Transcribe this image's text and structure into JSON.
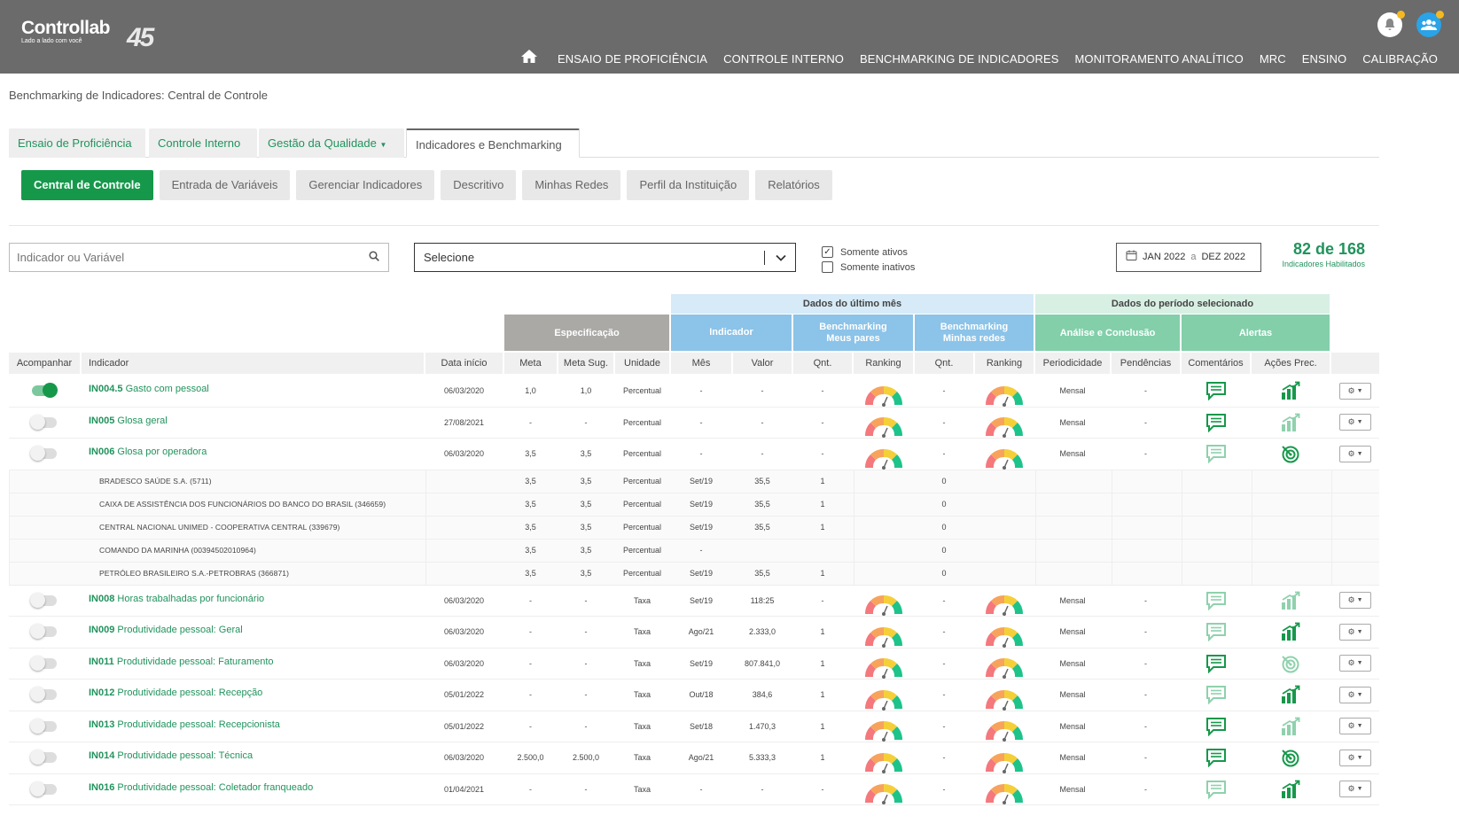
{
  "header": {
    "logo_text": "Controllab",
    "logo_tagline": "Lado a lado com você",
    "logo_anniversary": "45",
    "nav": [
      "ENSAIO DE PROFICIÊNCIA",
      "CONTROLE INTERNO",
      "BENCHMARKING DE INDICADORES",
      "MONITORAMENTO ANALÍTICO",
      "MRC",
      "ENSINO",
      "CALIBRAÇÃO"
    ]
  },
  "breadcrumb": "Benchmarking de Indicadores: Central de Controle",
  "tabs": [
    "Ensaio de Proficiência",
    "Controle Interno",
    "Gestão da Qualidade",
    "Indicadores e Benchmarking"
  ],
  "subtabs": [
    "Central de Controle",
    "Entrada de Variáveis",
    "Gerenciar Indicadores",
    "Descritivo",
    "Minhas Redes",
    "Perfil da Instituição",
    "Relatórios"
  ],
  "filters": {
    "search_placeholder": "Indicador ou Variável",
    "select_value": "Selecione",
    "only_active": "Somente ativos",
    "only_inactive": "Somente inativos",
    "date_from": "JAN 2022",
    "date_sep": "a",
    "date_to": "DEZ 2022",
    "count": "82 de 168",
    "count_label": "Indicadores Habilitados"
  },
  "table": {
    "group_last_month": "Dados do último mês",
    "group_period": "Dados do período selecionado",
    "sub_spec": "Especificação",
    "sub_indicator": "Indicador",
    "sub_bench_peers_1": "Benchmarking",
    "sub_bench_peers_2": "Meus pares",
    "sub_bench_nets_1": "Benchmarking",
    "sub_bench_nets_2": "Minhas redes",
    "sub_analysis": "Análise e Conclusão",
    "sub_alerts": "Alertas",
    "columns": [
      "Acompanhar",
      "Indicador",
      "Data início",
      "Meta",
      "Meta Sug.",
      "Unidade",
      "Mês",
      "Valor",
      "Qnt.",
      "Ranking",
      "Qnt.",
      "Ranking",
      "Periodicidade",
      "Pendências",
      "Comentários",
      "Ações Prec."
    ],
    "rows": [
      {
        "type": "main",
        "on": true,
        "code": "IN004.5",
        "name": "Gasto com pessoal",
        "start": "06/03/2020",
        "meta": "1,0",
        "meta_sug": "1,0",
        "unit": "Percentual",
        "month": "-",
        "value": "-",
        "qnt1": "-",
        "qnt2": "-",
        "period": "Mensal",
        "pend": "-",
        "comment": "dark",
        "action": "bars-dark"
      },
      {
        "type": "main",
        "on": false,
        "code": "IN005",
        "name": "Glosa geral",
        "start": "27/08/2021",
        "meta": "-",
        "meta_sug": "-",
        "unit": "Percentual",
        "month": "-",
        "value": "-",
        "qnt1": "-",
        "qnt2": "-",
        "period": "Mensal",
        "pend": "-",
        "comment": "dark",
        "action": "bars-light"
      },
      {
        "type": "main",
        "on": false,
        "code": "IN006",
        "name": "Glosa por operadora",
        "start": "06/03/2020",
        "meta": "3,5",
        "meta_sug": "3,5",
        "unit": "Percentual",
        "month": "-",
        "value": "-",
        "qnt1": "-",
        "qnt2": "-",
        "period": "Mensal",
        "pend": "-",
        "comment": "light",
        "action": "target-dark"
      },
      {
        "type": "sub",
        "name": "BRADESCO SAÚDE S.A. (5711)",
        "meta": "3,5",
        "meta_sug": "3,5",
        "unit": "Percentual",
        "month": "Set/19",
        "value": "35,5",
        "qnt1": "1",
        "qnt2": "0"
      },
      {
        "type": "sub",
        "name": "CAIXA DE ASSISTÊNCIA DOS FUNCIONÁRIOS DO BANCO DO BRASIL (346659)",
        "meta": "3,5",
        "meta_sug": "3,5",
        "unit": "Percentual",
        "month": "Set/19",
        "value": "35,5",
        "qnt1": "1",
        "qnt2": "0"
      },
      {
        "type": "sub",
        "name": "CENTRAL NACIONAL UNIMED - COOPERATIVA CENTRAL (339679)",
        "meta": "3,5",
        "meta_sug": "3,5",
        "unit": "Percentual",
        "month": "Set/19",
        "value": "35,5",
        "qnt1": "1",
        "qnt2": "0"
      },
      {
        "type": "sub",
        "name": "COMANDO DA MARINHA (00394502010964)",
        "meta": "3,5",
        "meta_sug": "3,5",
        "unit": "Percentual",
        "month": "-",
        "value": "",
        "qnt1": "",
        "qnt2": "0"
      },
      {
        "type": "sub",
        "name": "PETRÓLEO BRASILEIRO S.A.-PETROBRAS (366871)",
        "meta": "3,5",
        "meta_sug": "3,5",
        "unit": "Percentual",
        "month": "Set/19",
        "value": "35,5",
        "qnt1": "1",
        "qnt2": "0"
      },
      {
        "type": "main",
        "on": false,
        "code": "IN008",
        "name": "Horas trabalhadas por funcionário",
        "start": "06/03/2020",
        "meta": "-",
        "meta_sug": "-",
        "unit": "Taxa",
        "month": "Set/19",
        "value": "118:25",
        "qnt1": "-",
        "qnt2": "-",
        "period": "Mensal",
        "pend": "-",
        "comment": "light",
        "action": "bars-light"
      },
      {
        "type": "main",
        "on": false,
        "code": "IN009",
        "name": "Produtividade pessoal: Geral",
        "start": "06/03/2020",
        "meta": "-",
        "meta_sug": "-",
        "unit": "Taxa",
        "month": "Ago/21",
        "value": "2.333,0",
        "qnt1": "1",
        "qnt2": "-",
        "period": "Mensal",
        "pend": "-",
        "comment": "light",
        "action": "bars-dark"
      },
      {
        "type": "main",
        "on": false,
        "code": "IN011",
        "name": "Produtividade pessoal: Faturamento",
        "start": "06/03/2020",
        "meta": "-",
        "meta_sug": "-",
        "unit": "Taxa",
        "month": "Set/19",
        "value": "807.841,0",
        "qnt1": "1",
        "qnt2": "-",
        "period": "Mensal",
        "pend": "-",
        "comment": "dark",
        "action": "target-light"
      },
      {
        "type": "main",
        "on": false,
        "code": "IN012",
        "name": "Produtividade pessoal: Recepção",
        "start": "05/01/2022",
        "meta": "-",
        "meta_sug": "-",
        "unit": "Taxa",
        "month": "Out/18",
        "value": "384,6",
        "qnt1": "1",
        "qnt2": "-",
        "period": "Mensal",
        "pend": "-",
        "comment": "light",
        "action": "bars-dark"
      },
      {
        "type": "main",
        "on": false,
        "code": "IN013",
        "name": "Produtividade pessoal: Recepcionista",
        "start": "05/01/2022",
        "meta": "-",
        "meta_sug": "-",
        "unit": "Taxa",
        "month": "Set/18",
        "value": "1.470,3",
        "qnt1": "1",
        "qnt2": "-",
        "period": "Mensal",
        "pend": "-",
        "comment": "dark",
        "action": "bars-light"
      },
      {
        "type": "main",
        "on": false,
        "code": "IN014",
        "name": "Produtividade pessoal: Técnica",
        "start": "06/03/2020",
        "meta": "2.500,0",
        "meta_sug": "2.500,0",
        "unit": "Taxa",
        "month": "Ago/21",
        "value": "5.333,3",
        "qnt1": "1",
        "qnt2": "-",
        "period": "Mensal",
        "pend": "-",
        "comment": "dark",
        "action": "target-dark"
      },
      {
        "type": "main",
        "on": false,
        "code": "IN016",
        "name": "Produtividade pessoal: Coletador franqueado",
        "start": "01/04/2021",
        "meta": "-",
        "meta_sug": "-",
        "unit": "Taxa",
        "month": "-",
        "value": "-",
        "qnt1": "-",
        "qnt2": "-",
        "period": "Mensal",
        "pend": "-",
        "comment": "light",
        "action": "bars-dark"
      }
    ]
  },
  "colors": {
    "brand_green": "#16984b",
    "link_green": "#21935d",
    "header_gray": "#6b6b6b",
    "badge_yellow": "#f6b820"
  }
}
